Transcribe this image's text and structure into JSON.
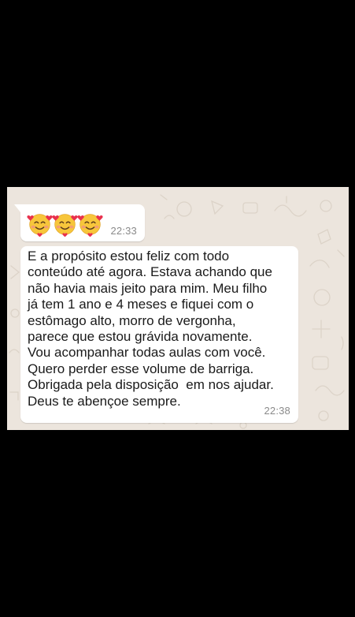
{
  "chat": {
    "messages": [
      {
        "content": "🥰🥰🥰",
        "time": "22:33"
      },
      {
        "content": "E a propósito estou feliz com todo conteúdo até agora. Estava achando que não havia mais jeito para mim. Meu filho já tem 1 ano e 4 meses e fiquei com o estômago alto, morro de vergonha, parece que estou grávida novamente. Vou acompanhar todas aulas com você. Quero perder esse volume de barriga. Obrigada pela disposição  em nos ajudar. Deus te abençoe sempre.",
        "lines": [
          "E a propósito estou feliz com todo",
          "conteúdo até agora. Estava achando que",
          "não havia mais jeito para mim. Meu filho",
          "já tem 1 ano e 4 meses e fiquei com o",
          "estômago alto, morro de vergonha,",
          "parece que estou grávida novamente.",
          "Vou acompanhar todas aulas com você.",
          "Quero perder esse volume de barriga.",
          "Obrigada pela disposição  em nos ajudar.",
          "Deus te abençoe sempre."
        ],
        "time": "22:38"
      }
    ],
    "emoji_icons": [
      "smiling-face-with-hearts-icon",
      "smiling-face-with-hearts-icon",
      "smiling-face-with-hearts-icon"
    ],
    "colors": {
      "wallpaper": "#ece5dd",
      "bubble": "#ffffff",
      "text": "#1a1a1a",
      "timestamp": "#8a8a8a",
      "outer_background": "#000000"
    }
  }
}
